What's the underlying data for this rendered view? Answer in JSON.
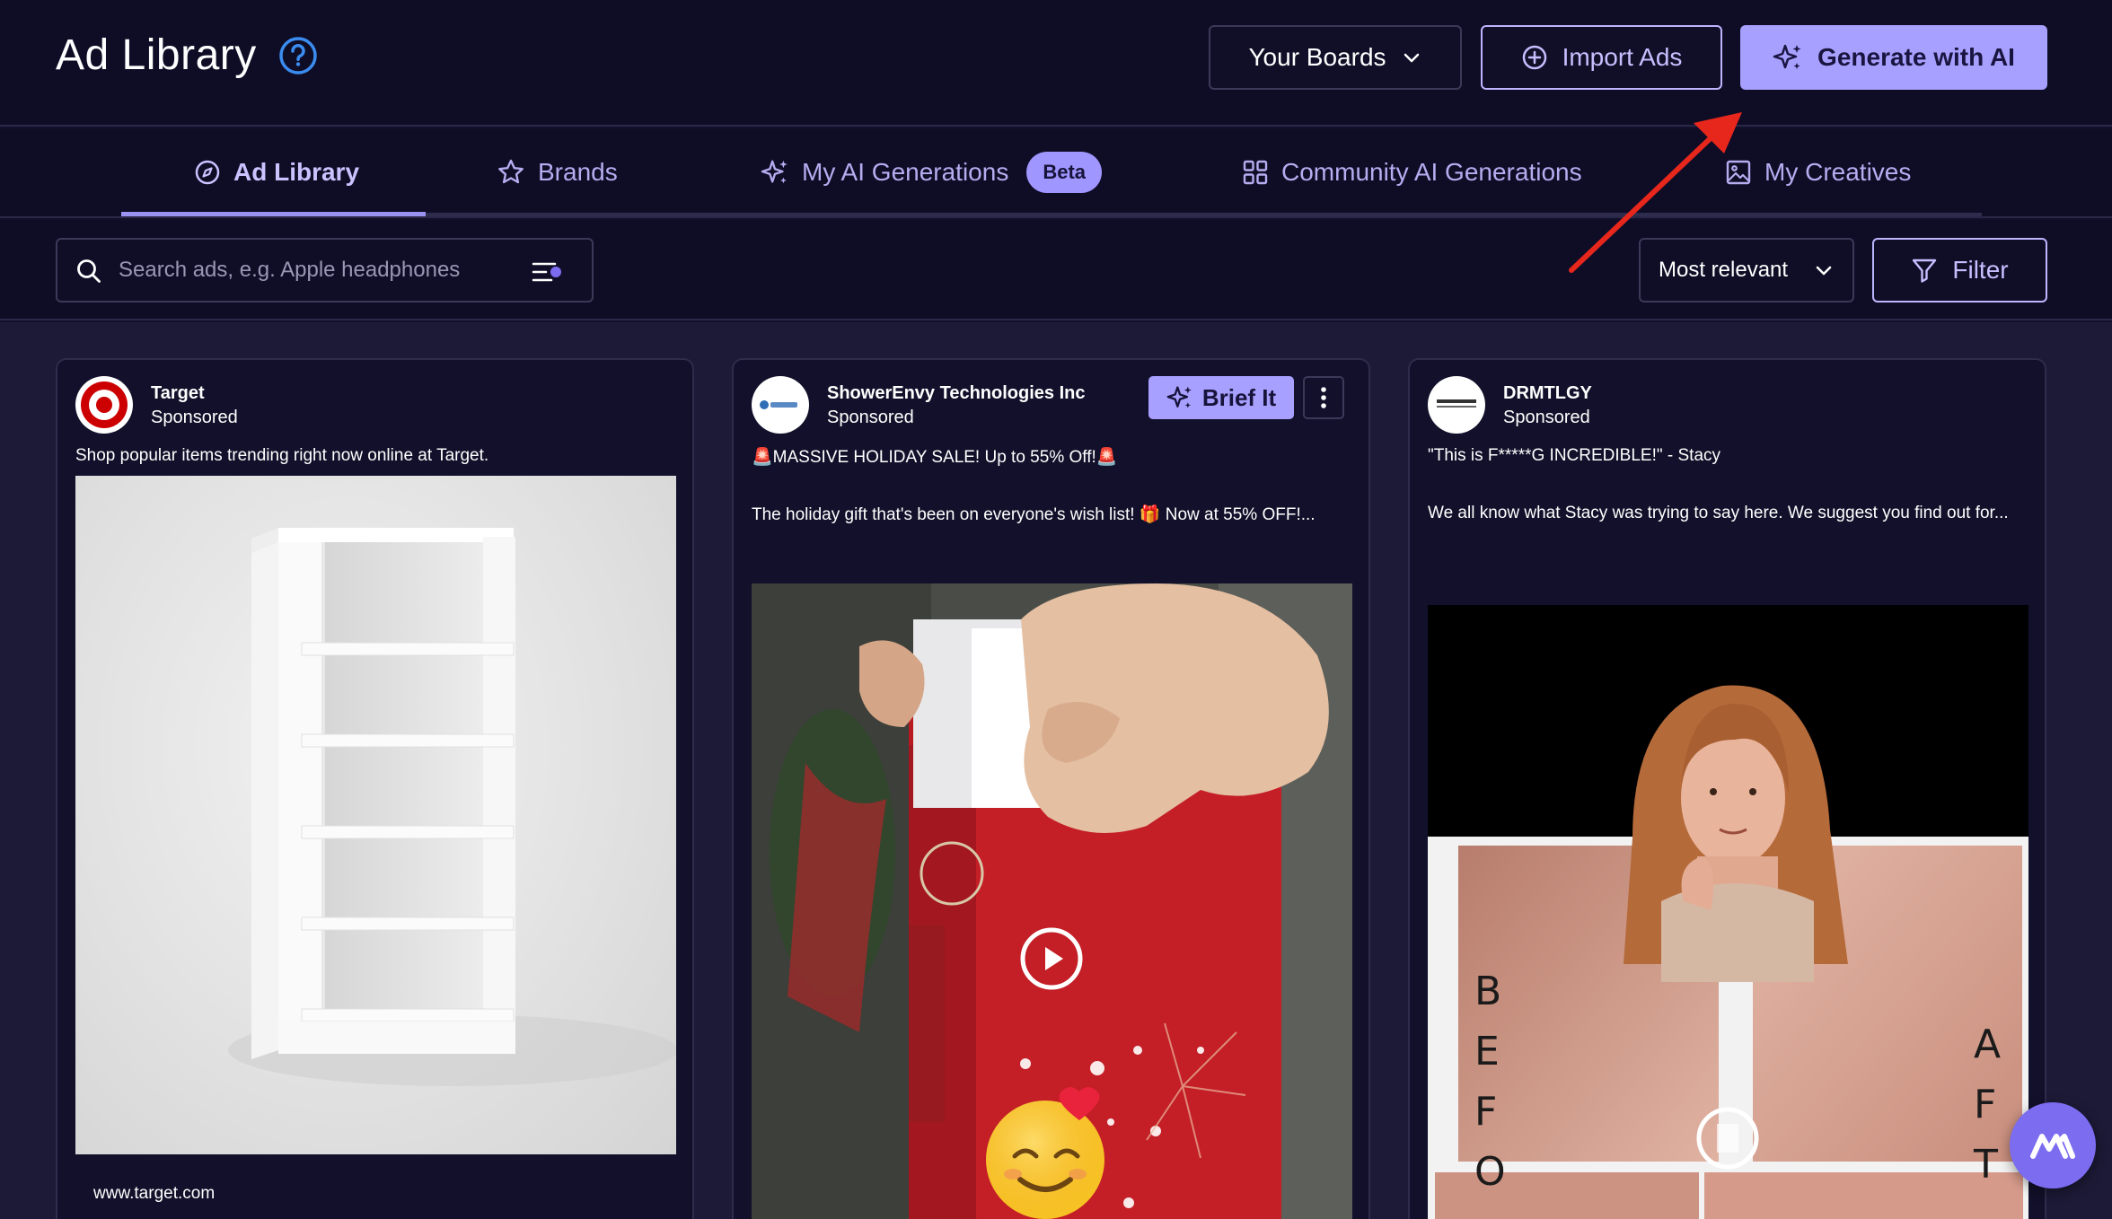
{
  "header": {
    "title": "Ad Library",
    "boards_label": "Your Boards",
    "import_label": "Import Ads",
    "generate_label": "Generate with AI"
  },
  "tabs": [
    {
      "label": "Ad Library",
      "icon": "compass-icon",
      "active": true
    },
    {
      "label": "Brands",
      "icon": "star-icon"
    },
    {
      "label": "My AI Generations",
      "icon": "sparkles-icon",
      "badge": "Beta"
    },
    {
      "label": "Community AI Generations",
      "icon": "grid-icon"
    },
    {
      "label": "My Creatives",
      "icon": "image-icon"
    }
  ],
  "search": {
    "placeholder": "Search ads, e.g. Apple headphones"
  },
  "sort": {
    "selected": "Most relevant"
  },
  "filter_label": "Filter",
  "cards": [
    {
      "brand": "Target",
      "sponsored": "Sponsored",
      "text": "Shop popular items trending right now online at Target.",
      "url": "www.target.com"
    },
    {
      "brand": "ShowerEnvy Technologies Inc",
      "sponsored": "Sponsored",
      "text1": "🚨MASSIVE HOLIDAY SALE! Up to 55% Off!🚨",
      "text2": "The holiday gift that's been on everyone's wish list! 🎁 Now at 55% OFF!...",
      "brief_label": "Brief It"
    },
    {
      "brand": "DRMTLGY",
      "sponsored": "Sponsored",
      "text1": "\"This is F*****G INCREDIBLE!\" - Stacy",
      "text2": "We all know what Stacy was trying to say here. We suggest you find out for...",
      "before_letters": [
        "B",
        "E",
        "F",
        "O"
      ],
      "after_letters": [
        "A",
        "F",
        "T"
      ]
    }
  ],
  "colors": {
    "background": "#12102b",
    "accent": "#a8a0ff",
    "tab_text": "#b4adf0",
    "annotation_arrow": "#e8271c"
  }
}
